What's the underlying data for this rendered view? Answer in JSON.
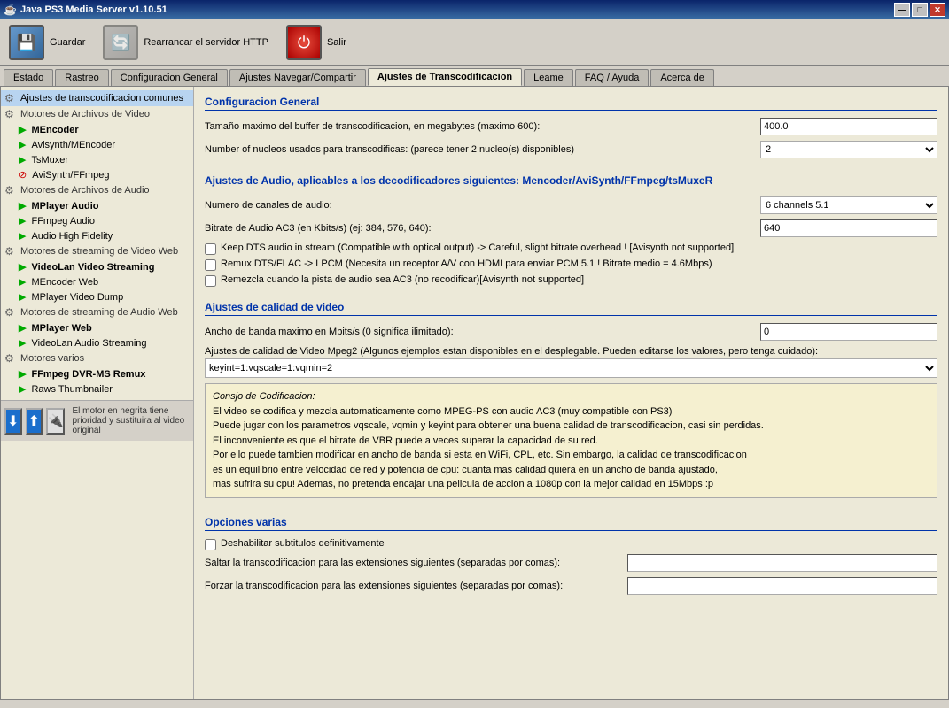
{
  "titleBar": {
    "title": "Java PS3 Media Server v1.10.51",
    "icon": "☕",
    "buttons": {
      "minimize": "—",
      "maximize": "□",
      "close": "✕"
    }
  },
  "toolbar": {
    "save": {
      "label": "Guardar",
      "icon": "💾"
    },
    "restart": {
      "label": "Rearrancar el servidor HTTP",
      "icon": "🔄"
    },
    "quit": {
      "label": "Salir",
      "icon": "⏻"
    }
  },
  "tabs": [
    {
      "id": "estado",
      "label": "Estado"
    },
    {
      "id": "rastreo",
      "label": "Rastreo"
    },
    {
      "id": "config-general",
      "label": "Configuracion General"
    },
    {
      "id": "ajustes-nav",
      "label": "Ajustes Navegar/Compartir"
    },
    {
      "id": "ajustes-trans",
      "label": "Ajustes de Transcodificacion",
      "active": true
    },
    {
      "id": "leame",
      "label": "Leame"
    },
    {
      "id": "faq",
      "label": "FAQ / Ayuda"
    },
    {
      "id": "acerca",
      "label": "Acerca de"
    }
  ],
  "sidebar": {
    "sections": [
      {
        "type": "header",
        "label": "Ajustes de transcodificacion comunes",
        "selected": true,
        "icon": "gear"
      },
      {
        "type": "header",
        "label": "Motores de Archivos de Video",
        "icon": "gear"
      },
      {
        "type": "item",
        "label": "MEncoder",
        "indent": 2,
        "arrow": "green",
        "bold": true
      },
      {
        "type": "item",
        "label": "Avisynth/MEncoder",
        "indent": 2,
        "arrow": "green"
      },
      {
        "type": "item",
        "label": "TsMuxer",
        "indent": 2,
        "arrow": "green"
      },
      {
        "type": "item",
        "label": "AviSynth/FFmpeg",
        "indent": 2,
        "arrow": "red"
      },
      {
        "type": "header",
        "label": "Motores de Archivos de Audio",
        "icon": "gear"
      },
      {
        "type": "item",
        "label": "MPlayer Audio",
        "indent": 2,
        "arrow": "green",
        "bold": true
      },
      {
        "type": "item",
        "label": "FFmpeg Audio",
        "indent": 2,
        "arrow": "green"
      },
      {
        "type": "item",
        "label": "Audio High Fidelity",
        "indent": 2,
        "arrow": "green"
      },
      {
        "type": "header",
        "label": "Motores de streaming de Video Web",
        "icon": "gear"
      },
      {
        "type": "item",
        "label": "VideoLan Video Streaming",
        "indent": 2,
        "arrow": "green",
        "bold": true
      },
      {
        "type": "item",
        "label": "MEncoder Web",
        "indent": 2,
        "arrow": "green"
      },
      {
        "type": "item",
        "label": "MPlayer Video Dump",
        "indent": 2,
        "arrow": "green"
      },
      {
        "type": "header",
        "label": "Motores de streaming de Audio Web",
        "icon": "gear"
      },
      {
        "type": "item",
        "label": "MPlayer Web",
        "indent": 2,
        "arrow": "green",
        "bold": true
      },
      {
        "type": "item",
        "label": "VideoLan Audio Streaming",
        "indent": 2,
        "arrow": "green"
      },
      {
        "type": "header",
        "label": "Motores varios",
        "icon": "gear"
      },
      {
        "type": "item",
        "label": "FFmpeg DVR-MS Remux",
        "indent": 2,
        "arrow": "green",
        "bold": true
      },
      {
        "type": "item",
        "label": "Raws Thumbnailer",
        "indent": 2,
        "arrow": "green"
      }
    ]
  },
  "bottomBar": {
    "text": "El motor en negrita tiene prioridad y sustituira al video original"
  },
  "content": {
    "section1": {
      "title": "Configuracion General",
      "fields": [
        {
          "label": "Tamaño maximo del buffer de transcodificacion, en megabytes (maximo 600):",
          "value": "400.0",
          "type": "input"
        },
        {
          "label": "Number of nucleos usados para transcodificas: (parece tener  2 nucleo(s) disponibles)",
          "value": "2",
          "type": "select"
        }
      ]
    },
    "section2": {
      "title": "Ajustes de Audio, aplicables a los decodificadores siguientes: Mencoder/AviSynth/FFmpeg/tsMuxeR",
      "fields": [
        {
          "label": "Numero de canales de audio:",
          "value": "6 channels 5.1",
          "type": "select"
        },
        {
          "label": "Bitrate de Audio AC3 (en Kbits/s) (ej: 384, 576, 640):",
          "value": "640",
          "type": "input"
        }
      ],
      "checkboxes": [
        {
          "label": "Keep DTS audio in stream (Compatible with optical output) -> Careful, slight bitrate overhead ! [Avisynth not supported]",
          "checked": false
        },
        {
          "label": "Remux DTS/FLAC -> LPCM (Necesita un receptor A/V con HDMI para enviar PCM 5.1 ! Bitrate medio = 4.6Mbps)",
          "checked": false
        },
        {
          "label": "Remezcla cuando la pista de audio sea AC3 (no recodificar)[Avisynth not supported]",
          "checked": false
        }
      ]
    },
    "section3": {
      "title": "Ajustes de calidad de video",
      "fields": [
        {
          "label": "Ancho de banda maximo en Mbits/s (0 significa ilimitado):",
          "value": "0",
          "type": "input"
        },
        {
          "label": "Ajustes de calidad de Video Mpeg2 (Algunos ejemplos estan disponibles en el desplegable. Pueden editarse los valores, pero tenga cuidado):",
          "value": "keyint=1:vqscale=1:vqmin=2",
          "type": "select-wide"
        }
      ]
    },
    "consejo": {
      "title": "Consjo de Codificacion:",
      "text": "El video se codifica y mezcla automaticamente como MPEG-PS con audio AC3 (muy compatible con PS3)\nPuede jugar con los parametros vqscale, vqmin y keyint para obtener una buena calidad de transcodificacion, casi sin perdidas.\nEl inconveniente es que el bitrate de VBR puede a veces superar la capacidad de su red.\nPor ello puede tambien modificar en ancho de banda si esta en WiFi, CPL, etc. Sin embargo, la calidad de transcodificacion\nes un equilibrio entre velocidad de red y potencia de cpu: cuanta mas calidad quiera en un ancho de banda ajustado,\nmas sufrira su cpu! Ademas, no pretenda encajar una pelicula de accion a 1080p con la mejor calidad en 15Mbps :p"
    },
    "section4": {
      "title": "Opciones varias",
      "checkboxes": [
        {
          "label": "Deshabilitar subtitulos definitivamente",
          "checked": false
        }
      ],
      "fields": [
        {
          "label": "Saltar la transcodificacion para las extensiones siguientes (separadas por comas):",
          "value": "",
          "type": "input"
        },
        {
          "label": "Forzar la transcodificacion para las extensiones siguientes (separadas por comas):",
          "value": "",
          "type": "input"
        }
      ]
    }
  }
}
